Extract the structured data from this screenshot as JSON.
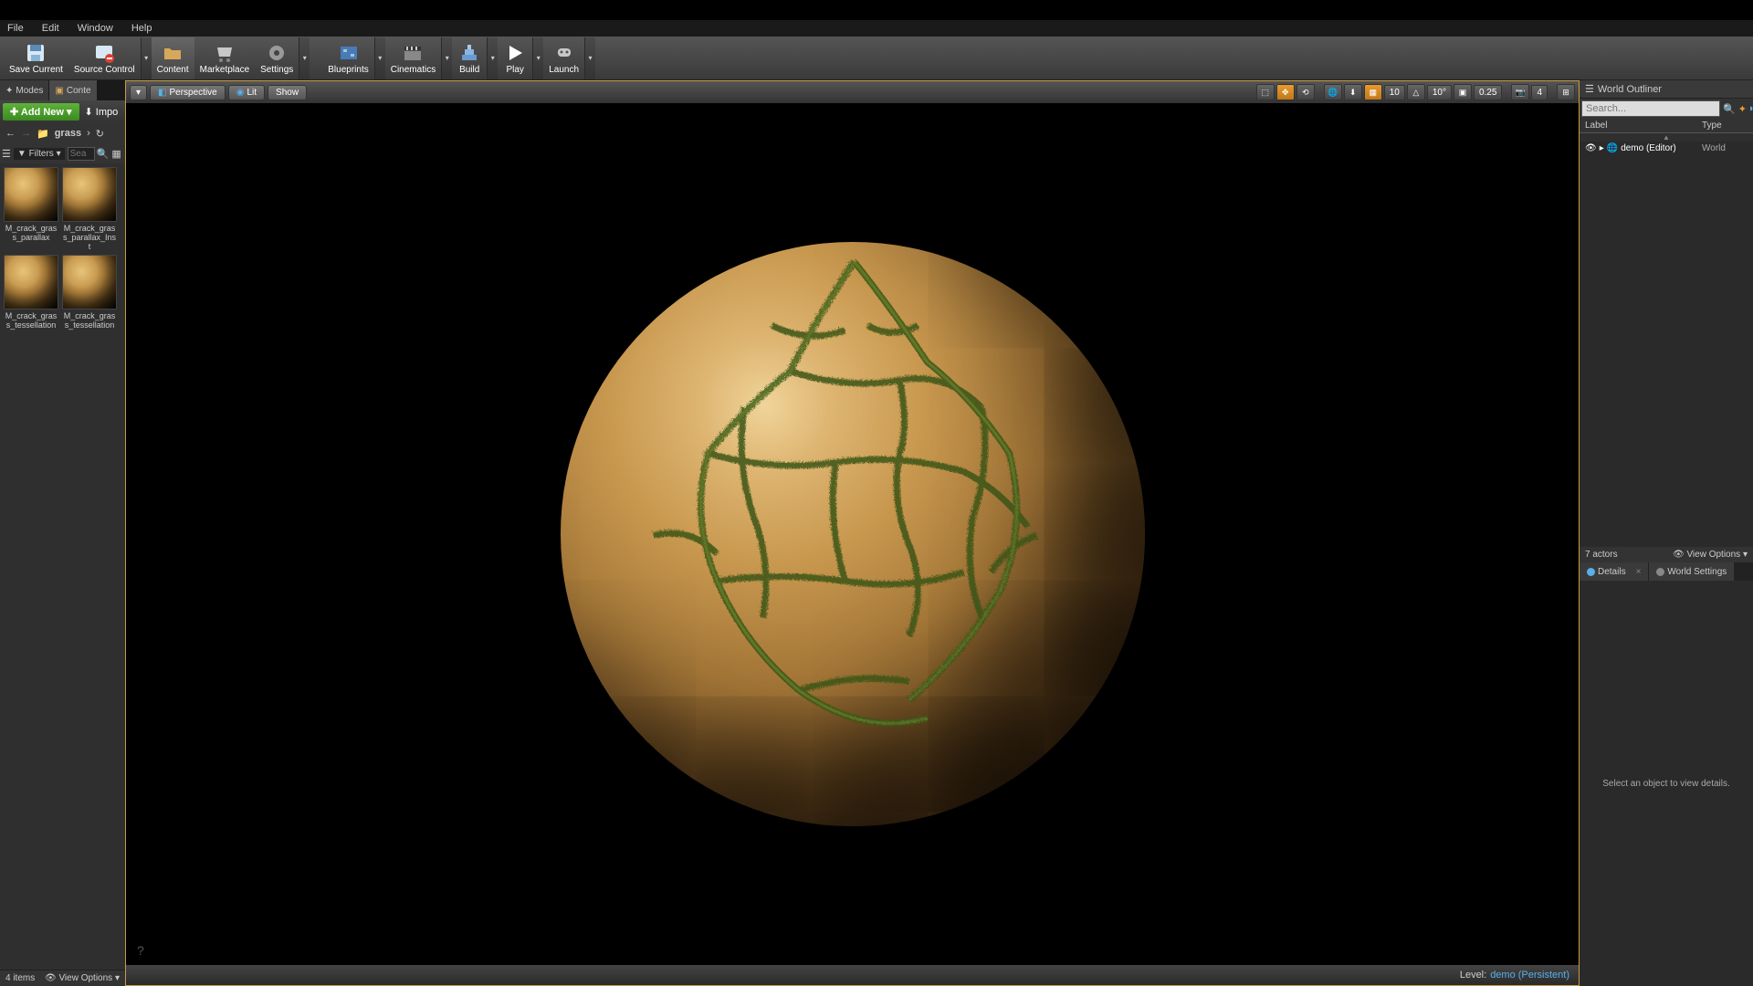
{
  "menu": {
    "file": "File",
    "edit": "Edit",
    "window": "Window",
    "help": "Help"
  },
  "toolbar": {
    "save": "Save Current",
    "source_control": "Source Control",
    "content": "Content",
    "marketplace": "Marketplace",
    "settings": "Settings",
    "blueprints": "Blueprints",
    "cinematics": "Cinematics",
    "build": "Build",
    "play": "Play",
    "launch": "Launch"
  },
  "left_tabs": {
    "modes": "Modes",
    "content": "Conte"
  },
  "add_new": "Add New",
  "import": "Impo",
  "path": {
    "folder": "grass"
  },
  "filters_label": "Filters",
  "search_placeholder": "Sea",
  "assets": [
    {
      "name": "M_crack_grass_parallax"
    },
    {
      "name": "M_crack_grass_parallax_Inst"
    },
    {
      "name": "M_crack_grass_tessellation"
    },
    {
      "name": "M_crack_grass_tessellation"
    }
  ],
  "asset_count": "4 items",
  "view_options": "View Options",
  "viewport": {
    "perspective": "Perspective",
    "lit": "Lit",
    "show": "Show",
    "snap_pos": "10",
    "snap_rot": "10°",
    "snap_scale": "0.25",
    "cam_speed": "4"
  },
  "level_label": "Level:",
  "level_name": "demo (Persistent)",
  "outliner": {
    "title": "World Outliner",
    "search_placeholder": "Search...",
    "label_col": "Label",
    "type_col": "Type",
    "item_name": "demo (Editor)",
    "item_type": "World",
    "count": "7 actors"
  },
  "details": {
    "tab1": "Details",
    "tab2": "World Settings",
    "empty": "Select an object to view details."
  }
}
